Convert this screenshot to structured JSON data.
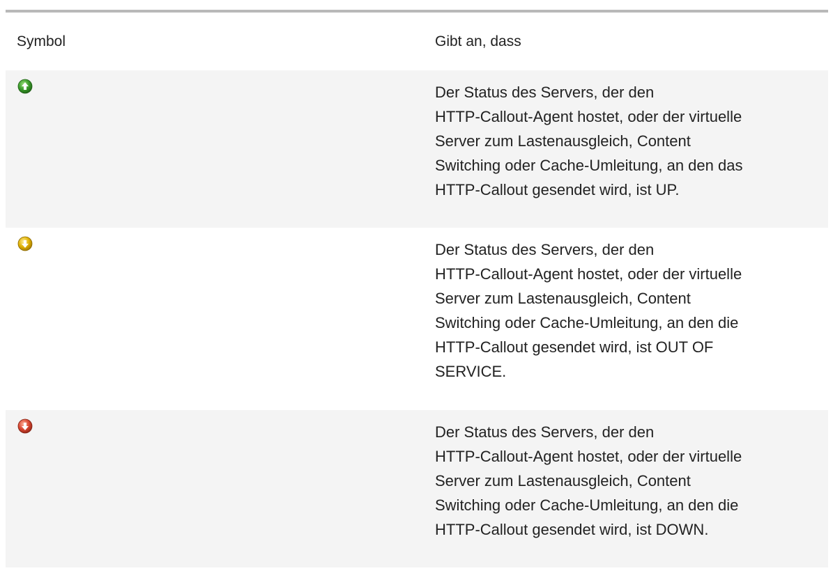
{
  "table": {
    "header": {
      "symbol": "Symbol",
      "description": "Gibt an, dass"
    },
    "rows": [
      {
        "icon": "status-up-icon",
        "icon_color": "#3a9a2a",
        "lines": [
          "Der Status des Servers, der den",
          "HTTP-Callout-Agent hostet, oder der virtuelle",
          "Server zum Lastenausgleich, Content",
          "Switching oder Cache-Umleitung, an den das",
          "HTTP-Callout gesendet wird, ist UP."
        ]
      },
      {
        "icon": "status-out-of-service-icon",
        "icon_color": "#e0b000",
        "lines": [
          "Der Status des Servers, der den",
          "HTTP-Callout-Agent hostet, oder der virtuelle",
          "Server zum Lastenausgleich, Content",
          "Switching oder Cache-Umleitung, an den die",
          "HTTP-Callout gesendet wird, ist OUT OF",
          "SERVICE."
        ]
      },
      {
        "icon": "status-down-icon",
        "icon_color": "#d8452f",
        "lines": [
          "Der Status des Servers, der den",
          "HTTP-Callout-Agent hostet, oder der virtuelle",
          "Server zum Lastenausgleich, Content",
          "Switching oder Cache-Umleitung, an den die",
          "HTTP-Callout gesendet wird, ist DOWN."
        ]
      }
    ]
  }
}
